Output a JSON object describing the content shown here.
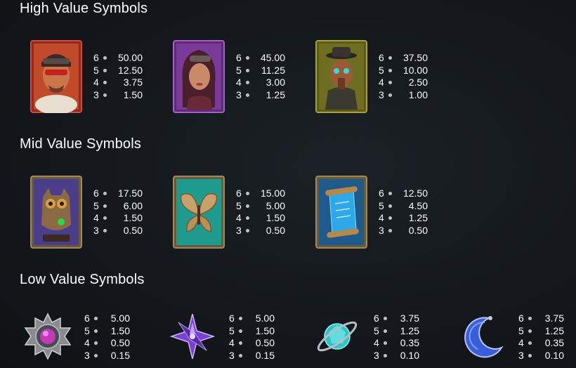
{
  "sections": {
    "high": {
      "title": "High Value Symbols"
    },
    "mid": {
      "title": "Mid Value Symbols"
    },
    "low": {
      "title": "Low Value Symbols"
    }
  },
  "high_symbols": [
    {
      "name": "aviator-man",
      "frame_color": "#b0332a",
      "payouts": [
        {
          "count": "6",
          "value": "50.00"
        },
        {
          "count": "5",
          "value": "12.50"
        },
        {
          "count": "4",
          "value": "3.75"
        },
        {
          "count": "3",
          "value": "1.50"
        }
      ]
    },
    {
      "name": "goggle-woman",
      "frame_color": "#8e4aa8",
      "payouts": [
        {
          "count": "6",
          "value": "45.00"
        },
        {
          "count": "5",
          "value": "11.25"
        },
        {
          "count": "4",
          "value": "3.00"
        },
        {
          "count": "3",
          "value": "1.25"
        }
      ]
    },
    {
      "name": "masked-gentleman",
      "frame_color": "#8d8a2a",
      "payouts": [
        {
          "count": "6",
          "value": "37.50"
        },
        {
          "count": "5",
          "value": "10.00"
        },
        {
          "count": "4",
          "value": "2.50"
        },
        {
          "count": "3",
          "value": "1.00"
        }
      ]
    }
  ],
  "mid_symbols": [
    {
      "name": "mechanical-owl",
      "frame_color": "#5a4aa8",
      "payouts": [
        {
          "count": "6",
          "value": "17.50"
        },
        {
          "count": "5",
          "value": "6.00"
        },
        {
          "count": "4",
          "value": "1.50"
        },
        {
          "count": "3",
          "value": "0.50"
        }
      ]
    },
    {
      "name": "brass-butterfly",
      "frame_color": "#1f9c8e",
      "payouts": [
        {
          "count": "6",
          "value": "15.00"
        },
        {
          "count": "5",
          "value": "5.00"
        },
        {
          "count": "4",
          "value": "1.50"
        },
        {
          "count": "3",
          "value": "0.50"
        }
      ]
    },
    {
      "name": "blueprint-scroll",
      "frame_color": "#2e7fb8",
      "payouts": [
        {
          "count": "6",
          "value": "12.50"
        },
        {
          "count": "5",
          "value": "4.50"
        },
        {
          "count": "4",
          "value": "1.25"
        },
        {
          "count": "3",
          "value": "0.50"
        }
      ]
    }
  ],
  "low_symbols": [
    {
      "name": "purple-sun-gem",
      "color": "#c23ab8",
      "payouts": [
        {
          "count": "6",
          "value": "5.00"
        },
        {
          "count": "5",
          "value": "1.50"
        },
        {
          "count": "4",
          "value": "0.50"
        },
        {
          "count": "3",
          "value": "0.15"
        }
      ]
    },
    {
      "name": "violet-star-gem",
      "color": "#7a3fd6",
      "payouts": [
        {
          "count": "6",
          "value": "5.00"
        },
        {
          "count": "5",
          "value": "1.50"
        },
        {
          "count": "4",
          "value": "0.50"
        },
        {
          "count": "3",
          "value": "0.15"
        }
      ]
    },
    {
      "name": "teal-planet-gem",
      "color": "#2ec4c4",
      "payouts": [
        {
          "count": "6",
          "value": "3.75"
        },
        {
          "count": "5",
          "value": "1.25"
        },
        {
          "count": "4",
          "value": "0.35"
        },
        {
          "count": "3",
          "value": "0.10"
        }
      ]
    },
    {
      "name": "blue-moon-gem",
      "color": "#3a5ed8",
      "payouts": [
        {
          "count": "6",
          "value": "3.75"
        },
        {
          "count": "5",
          "value": "1.25"
        },
        {
          "count": "4",
          "value": "0.35"
        },
        {
          "count": "3",
          "value": "0.10"
        }
      ]
    }
  ]
}
